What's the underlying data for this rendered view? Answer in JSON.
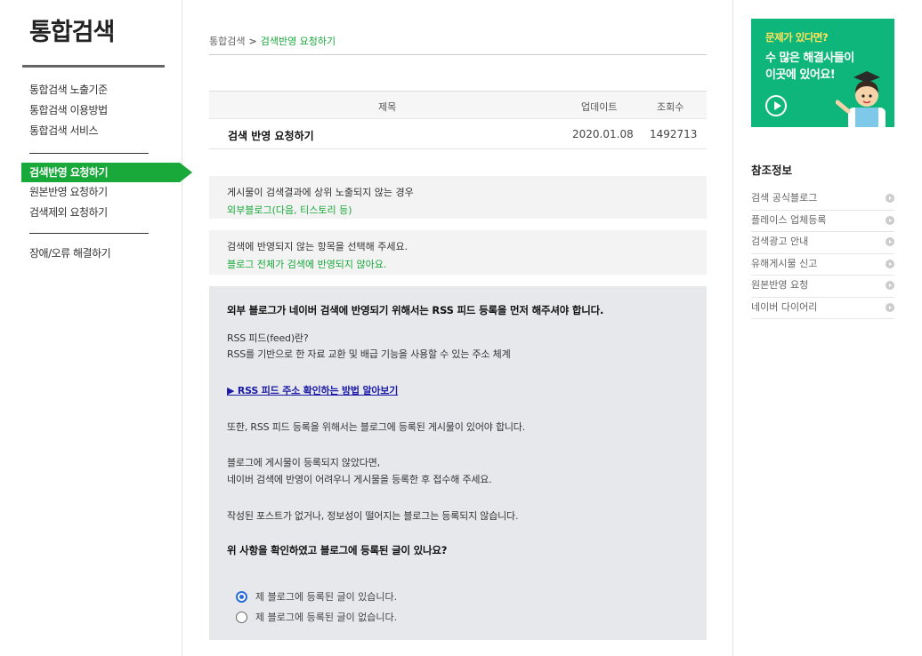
{
  "sidebar": {
    "title": "통합검색",
    "group1": [
      "통합검색 노출기준",
      "통합검색 이용방법",
      "통합검색 서비스"
    ],
    "active": "검색반영 요청하기",
    "group2": [
      "원본반영 요청하기",
      "검색제외 요청하기"
    ],
    "group3": [
      "장애/오류 해결하기"
    ]
  },
  "breadcrumb": {
    "root": "통합검색",
    "separator": ">",
    "current": "검색반영 요청하기"
  },
  "table": {
    "headers": [
      "제목",
      "업데이트",
      "조회수"
    ],
    "row": {
      "title": "검색 반영 요청하기",
      "date": "2020.01.08",
      "views": "1492713"
    }
  },
  "card1": {
    "question": "게시물이 검색결과에 상위 노출되지 않는 경우",
    "answer": "외부블로그(다음, 티스토리 등)"
  },
  "card2": {
    "question": "검색에 반영되지 않는 항목을 선택해 주세요.",
    "answer": "블로그 전체가 검색에 반영되지 않아요."
  },
  "info": {
    "heading": "외부 블로그가 네이버 검색에 반영되기 위해서는 RSS 피드 등록을 먼저 해주셔야 합니다.",
    "rss_q": "RSS 피드(feed)란?",
    "rss_def": "RSS를 기반으로 한 자료 교환 및 배급 기능을 사용할 수 있는 주소 체계",
    "link": "▶ RSS 피드 주소 확인하는 방법 알아보기",
    "note1": "또한, RSS 피드 등록을 위해서는 블로그에 등록된 게시물이 있어야 합니다.",
    "note2a": "블로그에 게시물이 등록되지 않았다면,",
    "note2b": "네이버 검색에 반영이 어려우니 게시물을 등록한 후 접수해 주세요.",
    "note3": "작성된 포스트가 없거나, 정보성이 떨어지는 블로그는 등록되지 않습니다.",
    "confirm": "위 사항을 확인하였고 블로그에 등록된 글이 있나요?",
    "option_yes": "제 블로그에 등록된 글이 있습니다.",
    "option_no": "제 블로그에 등록된 글이 없습니다.",
    "selected": "option_yes"
  },
  "banner": {
    "line1": "문제가 있다면?",
    "line2": "수 많은 해결사들이",
    "line3": "이곳에 있어요!",
    "bg_color": "#0fb67b"
  },
  "reference": {
    "title": "참조정보",
    "items": [
      "검색 공식블로그",
      "플레이스 업체등록",
      "검색광고 안내",
      "유해게시물 신고",
      "원본반영 요청",
      "네이버 다이어리"
    ]
  },
  "colors": {
    "accent": "#19a83a",
    "link": "#1a1aa6",
    "radio": "#2b6bd8"
  }
}
